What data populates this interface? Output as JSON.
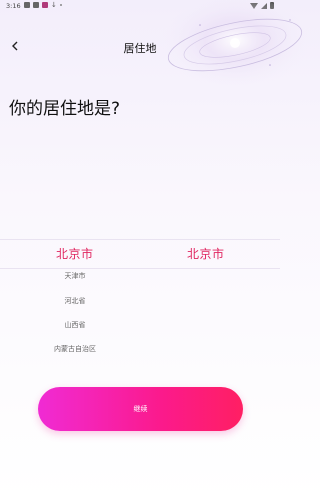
{
  "status_bar": {
    "time": "3:16",
    "icons": [
      "gallery-icon",
      "notification-icon",
      "app-icon",
      "download-icon",
      "dot-icon"
    ],
    "system_icons": [
      "wifi-icon",
      "signal-icon",
      "battery-icon"
    ]
  },
  "header": {
    "title": "居住地",
    "back_icon": "chevron-left-icon"
  },
  "question": "你的居住地是?",
  "picker": {
    "province_selected": "北京市",
    "city_selected": "北京市",
    "province_options": [
      "天津市",
      "河北省",
      "山西省",
      "内蒙古自治区"
    ]
  },
  "continue_button": {
    "label": "继续"
  },
  "colors": {
    "accent": "#e0245f",
    "button_gradient_start": "#f02bd4",
    "button_gradient_end": "#ff1f63"
  }
}
